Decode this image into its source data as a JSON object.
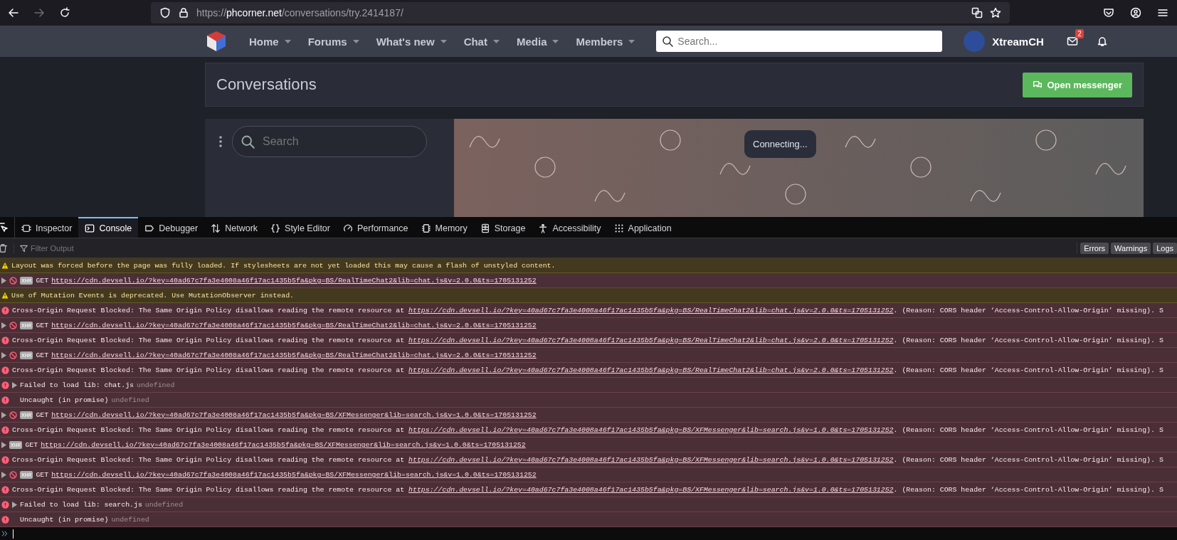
{
  "browser": {
    "url": {
      "scheme": "https://",
      "host": "phcorner.net",
      "path": "/conversations/try.2414187/"
    },
    "forward_disabled": true
  },
  "site": {
    "nav": [
      {
        "label": "Home"
      },
      {
        "label": "Forums"
      },
      {
        "label": "What's new"
      },
      {
        "label": "Chat"
      },
      {
        "label": "Media"
      },
      {
        "label": "Members"
      }
    ],
    "search_placeholder": "Search...",
    "user": "XtreamCH",
    "mail_badge": "2"
  },
  "page": {
    "title": "Conversations",
    "button": "Open messenger",
    "messenger": {
      "search_placeholder": "Search",
      "status": "Connecting..."
    }
  },
  "devtools": {
    "tabs": [
      {
        "label": "Inspector",
        "selected": false
      },
      {
        "label": "Console",
        "selected": true
      },
      {
        "label": "Debugger",
        "selected": false
      },
      {
        "label": "Network",
        "selected": false
      },
      {
        "label": "Style Editor",
        "selected": false
      },
      {
        "label": "Performance",
        "selected": false
      },
      {
        "label": "Memory",
        "selected": false
      },
      {
        "label": "Storage",
        "selected": false
      },
      {
        "label": "Accessibility",
        "selected": false
      },
      {
        "label": "Application",
        "selected": false
      }
    ],
    "filter_placeholder": "Filter Output",
    "filters": [
      {
        "label": "Errors",
        "selected": true
      },
      {
        "label": "Warnings",
        "selected": true
      },
      {
        "label": "Logs",
        "selected": true
      }
    ],
    "messages": [
      {
        "kind": "warning",
        "text": "Layout was forced before the page was fully loaded. If stylesheets are not yet loaded this may cause a flash of unstyled content."
      },
      {
        "kind": "network",
        "blocked": true,
        "badge": "XHR",
        "method": "GET",
        "url": "https://cdn.devsell.io/?key=40ad67c7fa3e4008a46f17ac1435b5fa&pkg=BS/RealTimeChat2&lib=chat.js&v=2.0.0&ts=1705131252"
      },
      {
        "kind": "warning",
        "text": "Use of Mutation Events is deprecated. Use MutationObserver instead."
      },
      {
        "kind": "cors",
        "text": "Cross-Origin Request Blocked: The Same Origin Policy disallows reading the remote resource at ",
        "url": "https://cdn.devsell.io/?key=40ad67c7fa3e4008a46f17ac1435b5fa&pkg=BS/RealTimeChat2&lib=chat.js&v=2.0.0&ts=1705131252",
        "tail": ". (Reason: CORS header ‘Access-Control-Allow-Origin’ missing). S"
      },
      {
        "kind": "network",
        "blocked": true,
        "badge": "XHR",
        "method": "GET",
        "url": "https://cdn.devsell.io/?key=40ad67c7fa3e4008a46f17ac1435b5fa&pkg=BS/RealTimeChat2&lib=chat.js&v=2.0.0&ts=1705131252"
      },
      {
        "kind": "cors",
        "text": "Cross-Origin Request Blocked: The Same Origin Policy disallows reading the remote resource at ",
        "url": "https://cdn.devsell.io/?key=40ad67c7fa3e4008a46f17ac1435b5fa&pkg=BS/RealTimeChat2&lib=chat.js&v=2.0.0&ts=1705131252",
        "tail": ". (Reason: CORS header ‘Access-Control-Allow-Origin’ missing). S"
      },
      {
        "kind": "network",
        "blocked": true,
        "badge": "XHR",
        "method": "GET",
        "url": "https://cdn.devsell.io/?key=40ad67c7fa3e4008a46f17ac1435b5fa&pkg=BS/RealTimeChat2&lib=chat.js&v=2.0.0&ts=1705131252"
      },
      {
        "kind": "cors",
        "text": "Cross-Origin Request Blocked: The Same Origin Policy disallows reading the remote resource at ",
        "url": "https://cdn.devsell.io/?key=40ad67c7fa3e4008a46f17ac1435b5fa&pkg=BS/RealTimeChat2&lib=chat.js&v=2.0.0&ts=1705131252",
        "tail": ". (Reason: CORS header ‘Access-Control-Allow-Origin’ missing). S"
      },
      {
        "kind": "error",
        "expandable": true,
        "text": "Failed to load lib: chat.js",
        "detail": "undefined"
      },
      {
        "kind": "error",
        "expandable": false,
        "text": "Uncaught (in promise)",
        "detail": "undefined"
      },
      {
        "kind": "network",
        "blocked": true,
        "badge": "XHR",
        "method": "GET",
        "url": "https://cdn.devsell.io/?key=40ad67c7fa3e4008a46f17ac1435b5fa&pkg=BS/XFMessenger&lib=search.js&v=1.0.0&ts=1705131252"
      },
      {
        "kind": "cors",
        "text": "Cross-Origin Request Blocked: The Same Origin Policy disallows reading the remote resource at ",
        "url": "https://cdn.devsell.io/?key=40ad67c7fa3e4008a46f17ac1435b5fa&pkg=BS/XFMessenger&lib=search.js&v=1.0.0&ts=1705131252",
        "tail": ". (Reason: CORS header ‘Access-Control-Allow-Origin’ missing). S"
      },
      {
        "kind": "network",
        "blocked": false,
        "badge": "XHR",
        "method": "GET",
        "url": "https://cdn.devsell.io/?key=40ad67c7fa3e4008a46f17ac1435b5fa&pkg=BS/XFMessenger&lib=search.js&v=1.0.0&ts=1705131252"
      },
      {
        "kind": "cors",
        "text": "Cross-Origin Request Blocked: The Same Origin Policy disallows reading the remote resource at ",
        "url": "https://cdn.devsell.io/?key=40ad67c7fa3e4008a46f17ac1435b5fa&pkg=BS/XFMessenger&lib=search.js&v=1.0.0&ts=1705131252",
        "tail": ". (Reason: CORS header ‘Access-Control-Allow-Origin’ missing). S"
      },
      {
        "kind": "network",
        "blocked": true,
        "badge": "XHR",
        "method": "GET",
        "url": "https://cdn.devsell.io/?key=40ad67c7fa3e4008a46f17ac1435b5fa&pkg=BS/XFMessenger&lib=search.js&v=1.0.0&ts=1705131252"
      },
      {
        "kind": "cors",
        "text": "Cross-Origin Request Blocked: The Same Origin Policy disallows reading the remote resource at ",
        "url": "https://cdn.devsell.io/?key=40ad67c7fa3e4008a46f17ac1435b5fa&pkg=BS/XFMessenger&lib=search.js&v=1.0.0&ts=1705131252",
        "tail": ". (Reason: CORS header ‘Access-Control-Allow-Origin’ missing). S"
      },
      {
        "kind": "error",
        "expandable": true,
        "text": "Failed to load lib: search.js",
        "detail": "undefined"
      },
      {
        "kind": "error",
        "expandable": false,
        "text": "Uncaught (in promise)",
        "detail": "undefined"
      }
    ]
  }
}
